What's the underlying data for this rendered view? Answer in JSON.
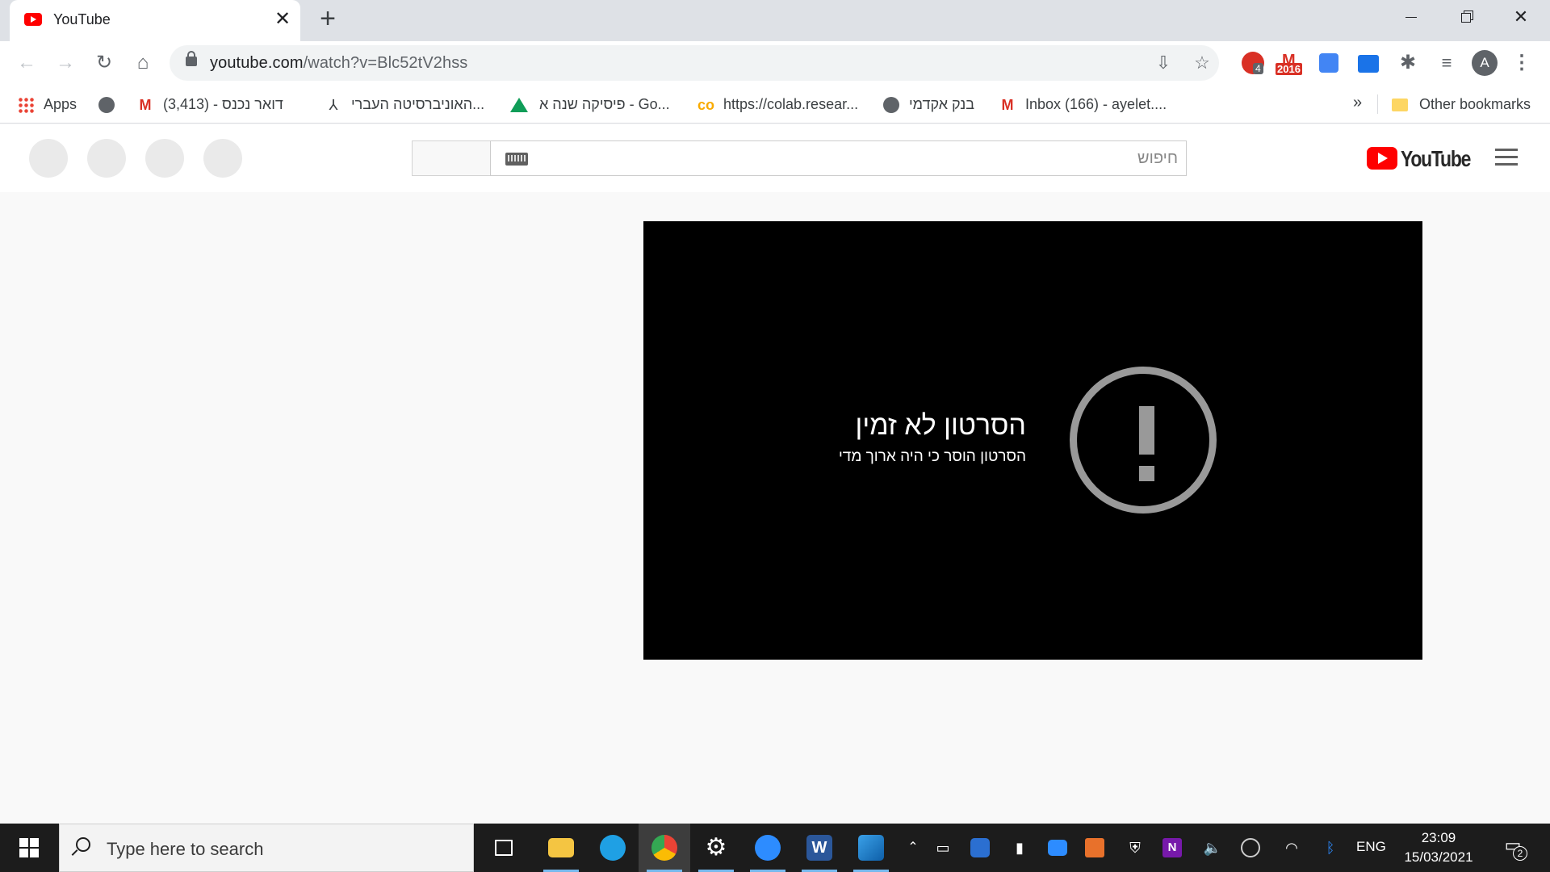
{
  "browser": {
    "tab": {
      "title": "YouTube",
      "close": "✕"
    },
    "new_tab": "+",
    "window": {
      "minimize": "",
      "maximize": "",
      "close": "✕"
    },
    "url": {
      "host": "youtube.com",
      "path": "/watch?v=Blc52tV2hss"
    },
    "profile_initial": "A",
    "extensions": {
      "adblock_badge": "4",
      "gmail_badge": "2016"
    },
    "bookmarks": [
      {
        "label": "Apps",
        "icon": "apps-grid-icon"
      },
      {
        "label": "",
        "icon": "globe-icon"
      },
      {
        "label": "דואר נכנס - (3,413)",
        "icon": "gmail-icon"
      },
      {
        "label": "האוניברסיטה העברי...",
        "icon": "huji-icon"
      },
      {
        "label": "פיסיקה שנה א - Go...",
        "icon": "google-drive-icon"
      },
      {
        "label": "https://colab.resear...",
        "icon": "colab-icon"
      },
      {
        "label": "בנק אקדמי",
        "icon": "globe-icon"
      },
      {
        "label": "Inbox (166) - ayelet....",
        "icon": "gmail-icon"
      }
    ],
    "more_bookmarks": "»",
    "other_bookmarks": "Other bookmarks"
  },
  "youtube": {
    "search_placeholder": "חיפוש",
    "logo_text": "YouTube",
    "player": {
      "error_title": "הסרטון לא זמין",
      "error_subtitle": "הסרטון הוסר כי היה ארוך מדי"
    }
  },
  "taskbar": {
    "search_placeholder": "Type here to search",
    "language": "ENG",
    "time": "23:09",
    "date": "15/03/2021",
    "notifications": "2",
    "apps": [
      "task-view",
      "file-explorer",
      "edge",
      "chrome",
      "settings",
      "zoom",
      "word",
      "photos"
    ]
  },
  "colors": {
    "youtube_red": "#ff0000",
    "player_bg": "#000000",
    "error_icon": "#999999",
    "taskbar_bg": "#1c1c1c"
  }
}
